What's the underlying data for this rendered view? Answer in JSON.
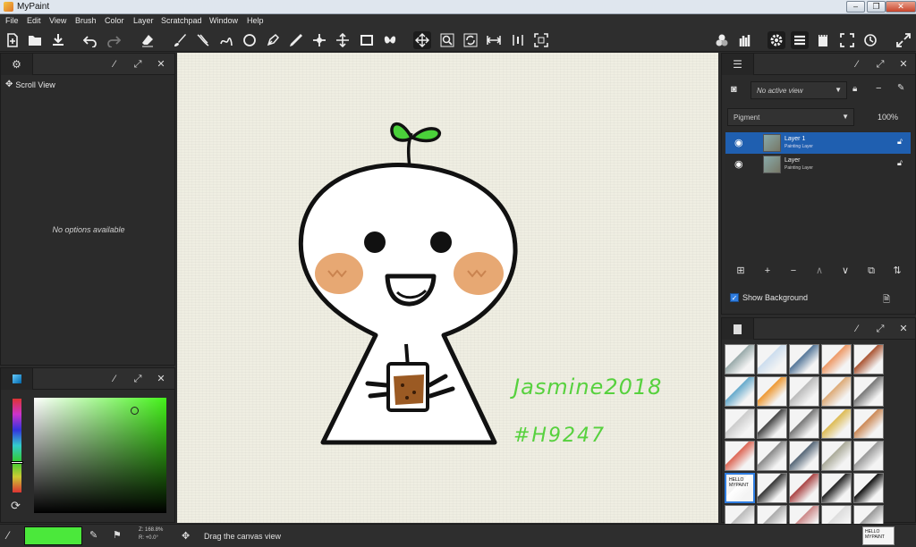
{
  "window": {
    "title": "MyPaint",
    "minimize": "–",
    "maximize": "❐",
    "close": "✕"
  },
  "menu": [
    "File",
    "Edit",
    "View",
    "Brush",
    "Color",
    "Layer",
    "Scratchpad",
    "Window",
    "Help"
  ],
  "toolbar_icons": [
    "new-file-icon",
    "open-file-icon",
    "save-icon",
    "undo-icon",
    "redo-icon",
    "eraser-icon",
    "brush-icon",
    "inking-icon",
    "freehand-icon",
    "ellipse-icon",
    "pen-icon",
    "color-picker-icon",
    "move-layer-icon",
    "frame-icon",
    "symmetry-icon",
    "scroll-view-icon",
    "zoom-view-icon",
    "rotate-view-icon",
    "flip-view-icon",
    "reset-view-icon",
    "fit-view-icon",
    "brush-history-icon",
    "brush-settings-icon",
    "settings-icon",
    "layers-icon",
    "scratchpad-icon",
    "fullscreen-icon",
    "history-icon",
    "expand-icon"
  ],
  "left_top_panel": {
    "tool_name": "Scroll View",
    "message": "No options available"
  },
  "color_panel": {
    "current_color": "#4be83b"
  },
  "layers_panel": {
    "view_label": "No active view",
    "mode": "Pigment",
    "opacity": "100%",
    "layers": [
      {
        "name": "Layer 1",
        "type": "Painting Layer",
        "selected": true
      },
      {
        "name": "Layer",
        "type": "Painting Layer",
        "selected": false
      }
    ],
    "show_background_label": "Show Background"
  },
  "status": {
    "zoom": "Z: 168.8%",
    "rotation": "R: +0.0°",
    "message": "Drag the canvas view"
  },
  "canvas_text": {
    "signature_line1": "Jasmine2018",
    "signature_line2": "#H9247"
  },
  "brushes_panel": {
    "thumbnail_label": "HELLO MYPAINT"
  }
}
